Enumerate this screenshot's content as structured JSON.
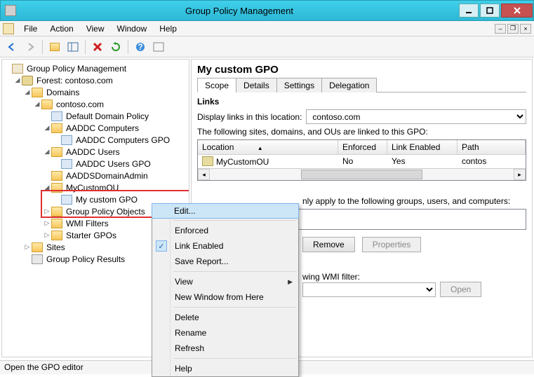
{
  "window": {
    "title": "Group Policy Management"
  },
  "menu": {
    "file": "File",
    "action": "Action",
    "view": "View",
    "window": "Window",
    "help": "Help"
  },
  "tree": {
    "root": "Group Policy Management",
    "forest": "Forest: contoso.com",
    "domains": "Domains",
    "domain": "contoso.com",
    "default_policy": "Default Domain Policy",
    "aaddc_computers": "AADDC Computers",
    "aaddc_computers_gpo": "AADDC Computers GPO",
    "aaddc_users": "AADDC Users",
    "aaddc_users_gpo": "AADDC Users GPO",
    "aadds_admin": "AADDSDomainAdmin",
    "my_ou": "MyCustomOU",
    "my_gpo": "My custom GPO",
    "gpo_container": "Group Policy Objects",
    "wmi": "WMI Filters",
    "starter": "Starter GPOs",
    "sites": "Sites",
    "results": "Group Policy Results"
  },
  "panel": {
    "title": "My custom GPO",
    "tabs": {
      "scope": "Scope",
      "details": "Details",
      "settings": "Settings",
      "delegation": "Delegation"
    },
    "links_header": "Links",
    "display_links_label": "Display links in this location:",
    "location_value": "contoso.com",
    "linked_text": "The following sites, domains, and OUs are linked to this GPO:",
    "cols": {
      "location": "Location",
      "enforced": "Enforced",
      "link_enabled": "Link Enabled",
      "path": "Path"
    },
    "row": {
      "location": "MyCustomOU",
      "enforced": "No",
      "link_enabled": "Yes",
      "path": "contos"
    },
    "security_text": "nly apply to the following groups, users, and computers:",
    "remove_btn": "Remove",
    "properties_btn": "Properties",
    "wmi_label": "wing WMI filter:",
    "open_btn": "Open"
  },
  "context": {
    "edit": "Edit...",
    "enforced": "Enforced",
    "link_enabled": "Link Enabled",
    "save_report": "Save Report...",
    "view": "View",
    "new_window": "New Window from Here",
    "delete": "Delete",
    "rename": "Rename",
    "refresh": "Refresh",
    "help": "Help"
  },
  "status": {
    "text": "Open the GPO editor"
  }
}
